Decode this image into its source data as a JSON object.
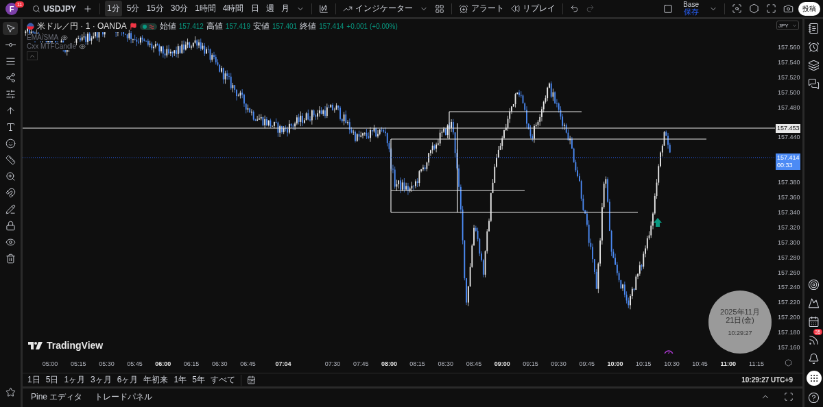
{
  "toolbar": {
    "avatar": "F",
    "avatar_badge": "11",
    "symbol": "USDJPY",
    "intervals": [
      {
        "label": "1分",
        "selected": true
      },
      {
        "label": "5分",
        "selected": false
      },
      {
        "label": "15分",
        "selected": false
      },
      {
        "label": "30分",
        "selected": false
      },
      {
        "label": "1時間",
        "selected": false
      },
      {
        "label": "4時間",
        "selected": false
      },
      {
        "label": "日",
        "selected": false
      },
      {
        "label": "週",
        "selected": false
      },
      {
        "label": "月",
        "selected": false
      }
    ],
    "indicators_label": "インジケーター",
    "alert_label": "アラート",
    "replay_label": "リプレイ",
    "layout_name": "Base",
    "layout_status": "保存",
    "publish_label": "投稿"
  },
  "legend": {
    "title": "米ドル／円 · 1 · OANDA",
    "ohlc": [
      {
        "label": "始値",
        "value": "157.412"
      },
      {
        "label": "高値",
        "value": "157.419"
      },
      {
        "label": "安値",
        "value": "157.401"
      },
      {
        "label": "終値",
        "value": "157.414"
      }
    ],
    "change": "+0.001 (+0.00%)",
    "indicators": [
      "EMA/SMA",
      "Cxx MTFCandle"
    ]
  },
  "price_axis": {
    "currency": "JPY",
    "ticks": [
      "157.560",
      "157.540",
      "157.520",
      "157.500",
      "157.480",
      "157.440",
      "157.380",
      "157.360",
      "157.340",
      "157.320",
      "157.300",
      "157.280",
      "157.260",
      "157.240",
      "157.220",
      "157.200",
      "157.180",
      "157.160"
    ],
    "line_label": "157.453",
    "last_price": "157.414",
    "countdown": "00:33"
  },
  "time_axis": {
    "ticks": [
      {
        "label": "05:00",
        "major": false
      },
      {
        "label": "05:15",
        "major": false
      },
      {
        "label": "05:30",
        "major": false
      },
      {
        "label": "05:45",
        "major": false
      },
      {
        "label": "06:00",
        "major": true
      },
      {
        "label": "06:15",
        "major": false
      },
      {
        "label": "06:30",
        "major": false
      },
      {
        "label": "06:45",
        "major": false
      },
      {
        "label": "07:04",
        "major": true
      },
      {
        "label": "07:30",
        "major": false
      },
      {
        "label": "07:45",
        "major": false
      },
      {
        "label": "08:00",
        "major": true
      },
      {
        "label": "08:15",
        "major": false
      },
      {
        "label": "08:30",
        "major": false
      },
      {
        "label": "08:45",
        "major": false
      },
      {
        "label": "09:00",
        "major": true
      },
      {
        "label": "09:15",
        "major": false
      },
      {
        "label": "09:30",
        "major": false
      },
      {
        "label": "09:45",
        "major": false
      },
      {
        "label": "10:00",
        "major": true
      },
      {
        "label": "10:15",
        "major": false
      },
      {
        "label": "10:30",
        "major": false
      },
      {
        "label": "10:45",
        "major": false
      },
      {
        "label": "11:00",
        "major": true
      },
      {
        "label": "11:15",
        "major": false
      }
    ]
  },
  "logo": "TradingView",
  "clock": {
    "date": "2025年11月21日(金)",
    "time": "10:29:27"
  },
  "range_bar": {
    "ranges": [
      "1日",
      "5日",
      "1ヶ月",
      "3ヶ月",
      "6ヶ月",
      "年初来",
      "1年",
      "5年",
      "すべて"
    ],
    "time": "10:29:27 UTC+9"
  },
  "bottom_panel": {
    "tabs": [
      "Pine エディタ",
      "トレードパネル"
    ]
  },
  "sidebar": {
    "alerts_badge": "35"
  }
}
